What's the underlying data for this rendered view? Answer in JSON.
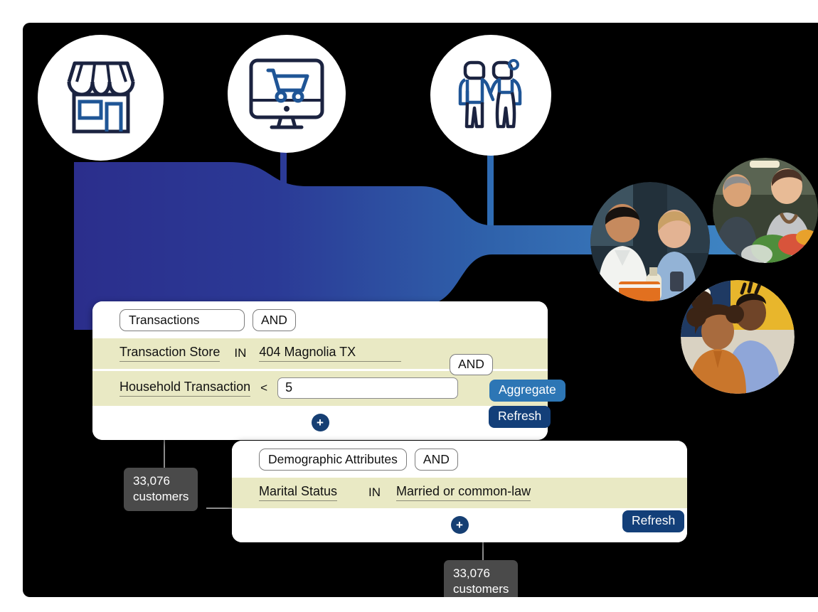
{
  "colors": {
    "canvas_bg": "#000000",
    "funnel_start": "#2b2e8c",
    "funnel_end": "#3f86c4",
    "icon_navy": "#1b2340",
    "icon_blue": "#1f5596",
    "row_bg": "#e9e9c4",
    "aggregate_btn": "#2d76b5",
    "refresh_btn": "#133f79",
    "plus_btn": "#163f73",
    "badge_bg": "#4a4a4a",
    "connector": "#8c8c8c"
  },
  "sources": [
    {
      "name": "store-icon",
      "label": "Physical Store"
    },
    {
      "name": "ecommerce-icon",
      "label": "Online Store"
    },
    {
      "name": "household-icon",
      "label": "Household"
    }
  ],
  "photos": [
    {
      "name": "shoppers-photo-1",
      "alt": "Couple comparing a product in store"
    },
    {
      "name": "shoppers-photo-2",
      "alt": "Couple with groceries at checkout"
    },
    {
      "name": "shoppers-photo-3",
      "alt": "Couple shopping together"
    }
  ],
  "panels": [
    {
      "entity": "Transactions",
      "logic": "AND",
      "conditions": [
        {
          "field": "Transaction Store",
          "operator": "IN",
          "value": "404 Magnolia TX",
          "input": false
        },
        {
          "field": "Household Transaction",
          "operator": "<",
          "value": "5",
          "input": true
        }
      ],
      "floating_logic": "AND",
      "aggregate_label": "Aggregate",
      "refresh_label": "Refresh",
      "add_label": "+"
    },
    {
      "entity": "Demographic Attributes",
      "logic": "AND",
      "conditions": [
        {
          "field": "Marital Status",
          "operator": "IN",
          "value": "Married or common-law",
          "input": false
        }
      ],
      "refresh_label": "Refresh",
      "add_label": "+"
    }
  ],
  "badges": [
    {
      "count": "33,076",
      "unit": "customers"
    },
    {
      "count": "33,076",
      "unit": "customers"
    }
  ]
}
